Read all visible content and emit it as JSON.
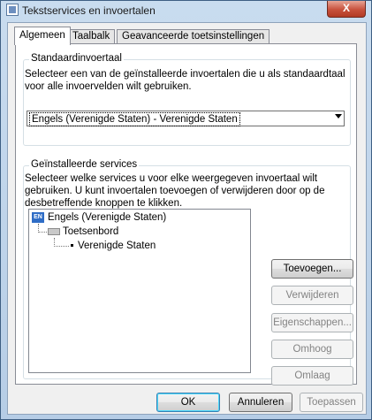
{
  "window": {
    "title": "Tekstservices en invoertalen",
    "close_glyph": "X"
  },
  "tabs": [
    {
      "label": "Algemeen",
      "active": true
    },
    {
      "label": "Taalbalk",
      "active": false
    },
    {
      "label": "Geavanceerde toetsinstellingen",
      "active": false
    }
  ],
  "default_language": {
    "legend": "Standaardinvoertaal",
    "description_line1": "Selecteer een van de geïnstalleerde invoertalen die u als standaardtaal",
    "description_line2": "voor alle invoervelden wilt gebruiken.",
    "selected": "Engels (Verenigde Staten) - Verenigde Staten"
  },
  "installed_services": {
    "legend": "Geïnstalleerde services",
    "description_line1": "Selecteer welke services u voor elke weergegeven invoertaal wilt",
    "description_line2": "gebruiken. U kunt invoertalen toevoegen of verwijderen door op de",
    "description_line3": "desbetreffende knoppen te klikken.",
    "tree": {
      "language_badge": "EN",
      "language": "Engels (Verenigde Staten)",
      "category": "Toetsenbord",
      "layout": "Verenigde Staten"
    },
    "buttons": {
      "add": "Toevoegen...",
      "remove": "Verwijderen",
      "properties": "Eigenschappen...",
      "move_up": "Omhoog",
      "move_down": "Omlaag"
    }
  },
  "footer": {
    "ok": "OK",
    "cancel": "Annuleren",
    "apply": "Toepassen"
  }
}
